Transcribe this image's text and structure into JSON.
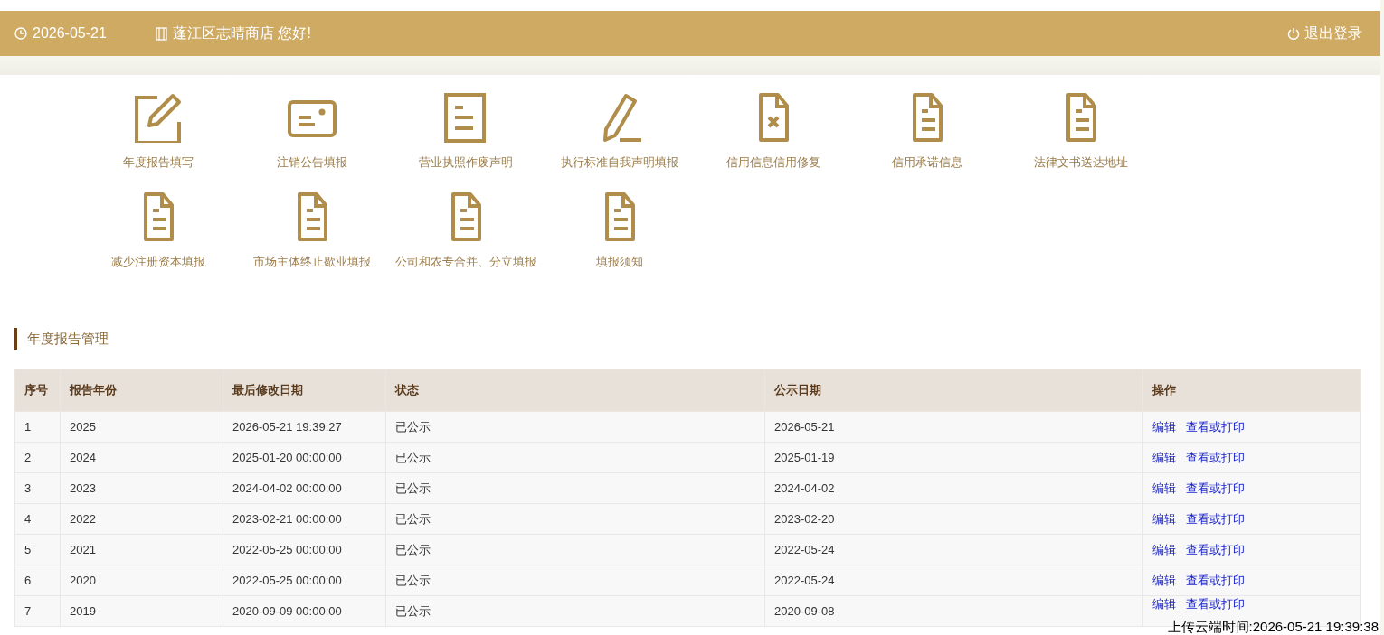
{
  "header": {
    "date": "2026-05-21",
    "greeting": "蓬江区志晴商店 您好!",
    "logout": "退出登录"
  },
  "tiles": [
    {
      "label": "年度报告填写",
      "kind": "edit"
    },
    {
      "label": "注销公告填报",
      "kind": "card"
    },
    {
      "label": "营业执照作废声明",
      "kind": "doc"
    },
    {
      "label": "执行标准自我声明填报",
      "kind": "pencil"
    },
    {
      "label": "信用信息信用修复",
      "kind": "void"
    },
    {
      "label": "信用承诺信息",
      "kind": "file"
    },
    {
      "label": "法律文书送达地址",
      "kind": "file"
    },
    {
      "label": "减少注册资本填报",
      "kind": "file"
    },
    {
      "label": "市场主体终止歇业填报",
      "kind": "file"
    },
    {
      "label": "公司和农专合并、分立填报",
      "kind": "file"
    },
    {
      "label": "填报须知",
      "kind": "file"
    }
  ],
  "section_title": "年度报告管理",
  "table": {
    "columns": [
      "序号",
      "报告年份",
      "最后修改日期",
      "状态",
      "公示日期",
      "操作"
    ],
    "rows": [
      {
        "cells": [
          "1",
          "2025",
          "2026-05-21 19:39:27",
          "已公示",
          "2026-05-21"
        ],
        "actions": [
          "编辑",
          "查看或打印"
        ]
      },
      {
        "cells": [
          "2",
          "2024",
          "2025-01-20 00:00:00",
          "已公示",
          "2025-01-19"
        ],
        "actions": [
          "编辑",
          "查看或打印"
        ]
      },
      {
        "cells": [
          "3",
          "2023",
          "2024-04-02 00:00:00",
          "已公示",
          "2024-04-02"
        ],
        "actions": [
          "编辑",
          "查看或打印"
        ]
      },
      {
        "cells": [
          "4",
          "2022",
          "2023-02-21 00:00:00",
          "已公示",
          "2023-02-20"
        ],
        "actions": [
          "编辑",
          "查看或打印"
        ]
      },
      {
        "cells": [
          "5",
          "2021",
          "2022-05-25 00:00:00",
          "已公示",
          "2022-05-24"
        ],
        "actions": [
          "编辑",
          "查看或打印"
        ]
      },
      {
        "cells": [
          "6",
          "2020",
          "2022-05-25 00:00:00",
          "已公示",
          "2022-05-24"
        ],
        "actions": [
          "编辑",
          "查看或打印"
        ]
      },
      {
        "cells": [
          "7",
          "2019",
          "2020-09-09 00:00:00",
          "已公示",
          "2020-09-08"
        ],
        "actions": [
          "编辑",
          "查看或打印"
        ]
      }
    ]
  },
  "upload_time": "上传云端时间:2026-05-21 19:39:38"
}
